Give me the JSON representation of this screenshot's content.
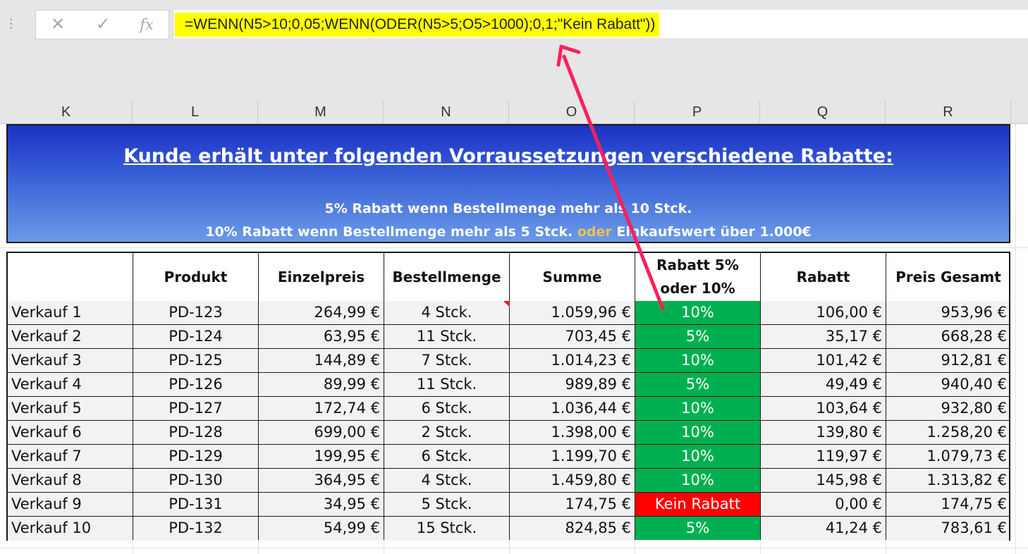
{
  "formula_bar": {
    "cancel_icon": "✕",
    "enter_icon": "✓",
    "fx_label": "fx",
    "formula": "=WENN(N5>10;0,05;WENN(ODER(N5>5;O5>1000);0,1;\"Kein Rabatt\"))",
    "highlight_color": "#ffff00"
  },
  "columns": [
    "K",
    "L",
    "M",
    "N",
    "O",
    "P",
    "Q",
    "R"
  ],
  "banner": {
    "title": "Kunde erhält unter folgenden Vorraussetzungen verschiedene Rabatte:",
    "line1": "5% Rabatt wenn Bestellmenge mehr als 10 Stck.",
    "line2_a": "10% Rabatt wenn Bestellmenge mehr als 5 Stck. ",
    "line2_oder": "oder",
    "line2_b": " Einkaufswert über 1.000€"
  },
  "table": {
    "headers": [
      "",
      "Produkt",
      "Einzelpreis",
      "Bestellmenge",
      "Summe",
      "Rabatt 5% oder 10%",
      "Rabatt",
      "Preis Gesamt"
    ],
    "rows": [
      {
        "label": "Verkauf 1",
        "produkt": "PD-123",
        "einzelpreis": "264,99 €",
        "menge": "4 Stck.",
        "summe": "1.059,96 €",
        "rabatt_pct": "10%",
        "rabatt": "106,00 €",
        "gesamt": "953,96 €"
      },
      {
        "label": "Verkauf 2",
        "produkt": "PD-124",
        "einzelpreis": "63,95 €",
        "menge": "11 Stck.",
        "summe": "703,45 €",
        "rabatt_pct": "5%",
        "rabatt": "35,17 €",
        "gesamt": "668,28 €"
      },
      {
        "label": "Verkauf 3",
        "produkt": "PD-125",
        "einzelpreis": "144,89 €",
        "menge": "7 Stck.",
        "summe": "1.014,23 €",
        "rabatt_pct": "10%",
        "rabatt": "101,42 €",
        "gesamt": "912,81 €"
      },
      {
        "label": "Verkauf 4",
        "produkt": "PD-126",
        "einzelpreis": "89,99 €",
        "menge": "11 Stck.",
        "summe": "989,89 €",
        "rabatt_pct": "5%",
        "rabatt": "49,49 €",
        "gesamt": "940,40 €"
      },
      {
        "label": "Verkauf 5",
        "produkt": "PD-127",
        "einzelpreis": "172,74 €",
        "menge": "6 Stck.",
        "summe": "1.036,44 €",
        "rabatt_pct": "10%",
        "rabatt": "103,64 €",
        "gesamt": "932,80 €"
      },
      {
        "label": "Verkauf 6",
        "produkt": "PD-128",
        "einzelpreis": "699,00 €",
        "menge": "2 Stck.",
        "summe": "1.398,00 €",
        "rabatt_pct": "10%",
        "rabatt": "139,80 €",
        "gesamt": "1.258,20 €"
      },
      {
        "label": "Verkauf 7",
        "produkt": "PD-129",
        "einzelpreis": "199,95 €",
        "menge": "6 Stck.",
        "summe": "1.199,70 €",
        "rabatt_pct": "10%",
        "rabatt": "119,97 €",
        "gesamt": "1.079,73 €"
      },
      {
        "label": "Verkauf 8",
        "produkt": "PD-130",
        "einzelpreis": "364,95 €",
        "menge": "4 Stck.",
        "summe": "1.459,80 €",
        "rabatt_pct": "10%",
        "rabatt": "145,98 €",
        "gesamt": "1.313,82 €"
      },
      {
        "label": "Verkauf 9",
        "produkt": "PD-131",
        "einzelpreis": "34,95 €",
        "menge": "5 Stck.",
        "summe": "174,75 €",
        "rabatt_pct": "Kein Rabatt",
        "rabatt": "0,00 €",
        "gesamt": "174,75 €"
      },
      {
        "label": "Verkauf 10",
        "produkt": "PD-132",
        "einzelpreis": "54,99 €",
        "menge": "15 Stck.",
        "summe": "824,85 €",
        "rabatt_pct": "5%",
        "rabatt": "41,24 €",
        "gesamt": "783,61 €"
      }
    ]
  },
  "colors": {
    "discount_green": "#00b050",
    "no_discount_red": "#ff0000",
    "arrow": "#ff1f5a",
    "oder_highlight": "#f2c14e"
  }
}
